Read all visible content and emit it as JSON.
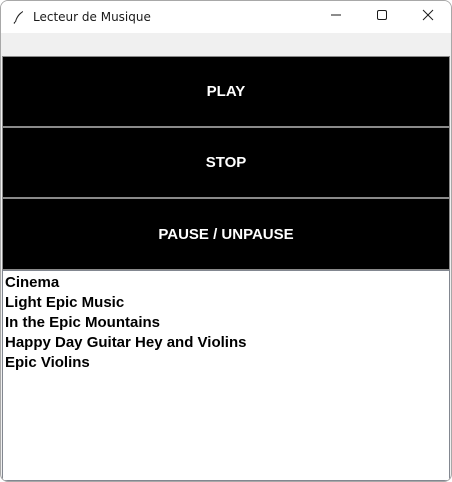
{
  "window": {
    "title": "Lecteur de Musique",
    "icon": "feather-icon"
  },
  "window_controls": {
    "minimize_icon": "minimize-icon",
    "maximize_icon": "maximize-icon",
    "close_icon": "close-icon"
  },
  "buttons": {
    "play_label": "PLAY",
    "stop_label": "STOP",
    "pause_label": "PAUSE / UNPAUSE"
  },
  "playlist": {
    "items": [
      "Cinema",
      "Light Epic Music",
      "In the Epic Mountains",
      "Happy Day Guitar Hey and Violins",
      "Epic Violins"
    ]
  },
  "colors": {
    "button_bg": "#000000",
    "button_text": "#ffffff",
    "list_bg": "#ffffff",
    "window_bg": "#f0f0f0"
  }
}
